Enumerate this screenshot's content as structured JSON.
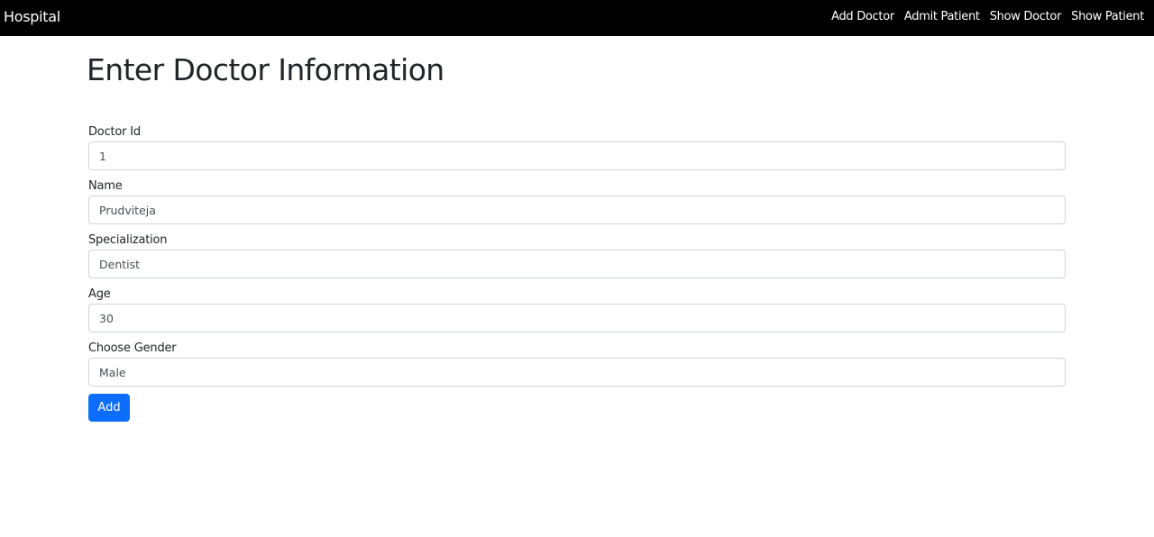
{
  "navbar": {
    "brand": "Hospital",
    "links": [
      {
        "label": "Add Doctor"
      },
      {
        "label": "Admit Patient"
      },
      {
        "label": "Show Doctor"
      },
      {
        "label": "Show Patient"
      }
    ]
  },
  "page": {
    "title": "Enter Doctor Information"
  },
  "form": {
    "fields": [
      {
        "label": "Doctor Id",
        "value": "1"
      },
      {
        "label": "Name",
        "value": "Prudviteja"
      },
      {
        "label": "Specialization",
        "value": "Dentist"
      },
      {
        "label": "Age",
        "value": "30"
      },
      {
        "label": "Choose Gender",
        "value": "Male"
      }
    ],
    "submit_label": "Add"
  },
  "colors": {
    "navbar_bg": "#000000",
    "primary_button": "#0d6efd",
    "input_border": "#ced4da"
  }
}
